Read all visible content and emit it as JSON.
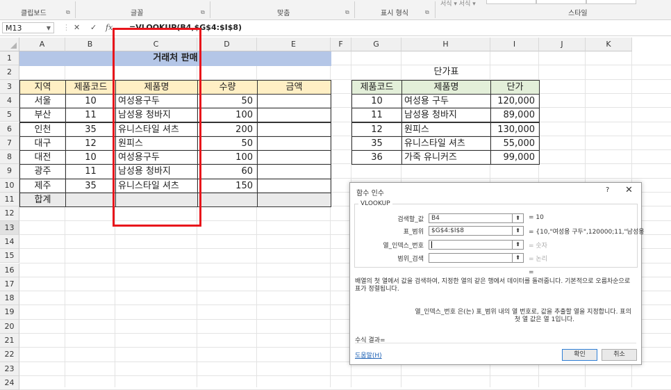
{
  "ribbon": {
    "groups": [
      "클립보드",
      "글꼴",
      "맞춤",
      "표시 형식",
      "스타일"
    ],
    "top_fragment": "서식 ▾ 서식 ▾"
  },
  "formula_bar": {
    "name_box": "M13",
    "cancel": "✕",
    "enter": "✓",
    "fx": "fx",
    "formula": "=VLOOKUP(B4,$G$4:$I$8)"
  },
  "columns": [
    "A",
    "B",
    "C",
    "D",
    "E",
    "F",
    "G",
    "H",
    "I",
    "J",
    "K"
  ],
  "rows": [
    "1",
    "2",
    "3",
    "4",
    "5",
    "6",
    "7",
    "8",
    "9",
    "10",
    "11",
    "12",
    "13",
    "14",
    "15",
    "16",
    "17",
    "18",
    "19",
    "20",
    "21",
    "22",
    "23",
    "24"
  ],
  "selected_row": "13",
  "sales": {
    "title": "거래처 판매",
    "headers": [
      "지역",
      "제품코드",
      "제품명",
      "수량",
      "금액"
    ],
    "rows": [
      [
        "서울",
        "10",
        "여성용구두",
        "50",
        ""
      ],
      [
        "부산",
        "11",
        "남성용 청바지",
        "100",
        ""
      ],
      [
        "인천",
        "35",
        "유니스타일 셔츠",
        "200",
        ""
      ],
      [
        "대구",
        "12",
        "원피스",
        "50",
        ""
      ],
      [
        "대전",
        "10",
        "여성용구두",
        "100",
        ""
      ],
      [
        "광주",
        "11",
        "남성용 청바지",
        "60",
        ""
      ],
      [
        "제주",
        "35",
        "유니스타일 셔츠",
        "150",
        ""
      ]
    ],
    "total_label": "합계"
  },
  "price_table": {
    "title": "단가표",
    "headers": [
      "제품코드",
      "제품명",
      "단가"
    ],
    "rows": [
      [
        "10",
        "여성용 구두",
        "120,000"
      ],
      [
        "11",
        "남성용 청바지",
        "89,000"
      ],
      [
        "12",
        "원피스",
        "130,000"
      ],
      [
        "35",
        "유니스타일 셔츠",
        "55,000"
      ],
      [
        "36",
        "가죽 유니커즈",
        "99,000"
      ]
    ]
  },
  "dialog": {
    "title": "함수 인수",
    "help_q": "?",
    "close": "✕",
    "function_name": "VLOOKUP",
    "args": [
      {
        "label": "검색할_값",
        "value": "B4",
        "result": "= 10"
      },
      {
        "label": "표_범위",
        "value": "$G$4:$I$8",
        "result": "= {10,\"여성용 구두\",120000;11,\"남성용"
      },
      {
        "label": "열_인덱스_번호",
        "value": "",
        "result": "= 숫자"
      },
      {
        "label": "범위_검색",
        "value": "",
        "result": "= 논리"
      }
    ],
    "equals": "=",
    "description": "배열의 첫 열에서 값을 검색하여, 지정한 열의 같은 행에서 데이터를 돌려줍니다. 기본적으로 오름차순으로 표가 정렬됩니다.",
    "arg_desc_label": "열_인덱스_번호",
    "arg_desc_text": "은(는) 표_범위 내의 열 번호로, 값을 추출할 열을 지정합니다. 표의 첫 열 값은 열 1입니다.",
    "result_label": "수식 결과=",
    "help_link": "도움말(H)",
    "ok": "확인",
    "cancel": "취소"
  }
}
